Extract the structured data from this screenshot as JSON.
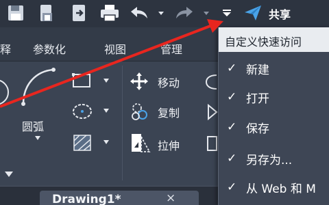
{
  "quick_access": {
    "share_label": "共享",
    "icons": [
      "save-icon",
      "save-as-icon",
      "export-icon",
      "print-icon",
      "undo-icon",
      "redo-icon",
      "customize-dropdown-icon",
      "share-icon"
    ]
  },
  "ribbon_tabs": [
    "释",
    "参数化",
    "视图",
    "管理"
  ],
  "ribbon": {
    "arc_label": "圆弧",
    "move_label": "移动",
    "copy_label": "复制",
    "stretch_label": "拉伸"
  },
  "file_tab": {
    "title": "Drawing1*",
    "close": "×"
  },
  "dropdown": {
    "header": "自定义快速访问",
    "items": [
      {
        "check": "✓",
        "label": "新建"
      },
      {
        "check": "✓",
        "label": "打开"
      },
      {
        "check": "✓",
        "label": "保存"
      },
      {
        "check": "✓",
        "label": "另存为..."
      },
      {
        "check": "✓",
        "label": "从 Web 和 M"
      }
    ]
  },
  "colors": {
    "annotation_arrow": "#e8261f",
    "toolbar_bg": "#2d3440",
    "ribbon_bg": "#3b4453",
    "menu_header_bg": "#e9ecf0"
  }
}
